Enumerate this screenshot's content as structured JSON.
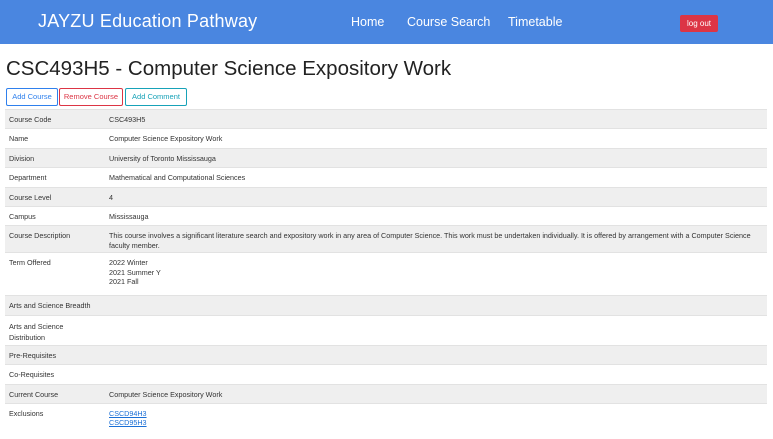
{
  "navbar": {
    "brand": "JAYZU Education Pathway",
    "links": [
      "Home",
      "Course Search",
      "Timetable"
    ],
    "logout": "log out"
  },
  "page": {
    "title": "CSC493H5 - Computer Science Expository Work"
  },
  "actions": {
    "add": "Add Course",
    "remove": "Remove Course",
    "comment": "Add Comment"
  },
  "details": {
    "code": {
      "label": "Course Code",
      "value": "CSC493H5"
    },
    "name": {
      "label": "Name",
      "value": "Computer Science Expository Work"
    },
    "division": {
      "label": "Division",
      "value": "University of Toronto Mississauga"
    },
    "department": {
      "label": "Department",
      "value": "Mathematical and Computational Sciences"
    },
    "level": {
      "label": "Course Level",
      "value": "4"
    },
    "campus": {
      "label": "Campus",
      "value": "Mississauga"
    },
    "description": {
      "label": "Course Description",
      "value": "This course involves a significant literature search and expository work in any area of Computer Science. This work must be undertaken individually. It is offered by arrangement with a Computer Science faculty member."
    },
    "term": {
      "label": "Term Offered",
      "values": [
        "2022 Winter",
        "2021 Summer Y",
        "2021 Fall"
      ]
    },
    "breadth": {
      "label": "Arts and Science Breadth",
      "value": ""
    },
    "distribution": {
      "label": "Arts and Science Distribution",
      "value": ""
    },
    "prereq": {
      "label": "Pre-Requisites",
      "value": ""
    },
    "coreq": {
      "label": "Co-Requisites",
      "value": ""
    },
    "current": {
      "label": "Current Course",
      "value": "Computer Science Expository Work"
    },
    "exclusions": {
      "label": "Exclusions",
      "values": [
        "CSCD94H3",
        "CSCD95H3"
      ]
    }
  }
}
